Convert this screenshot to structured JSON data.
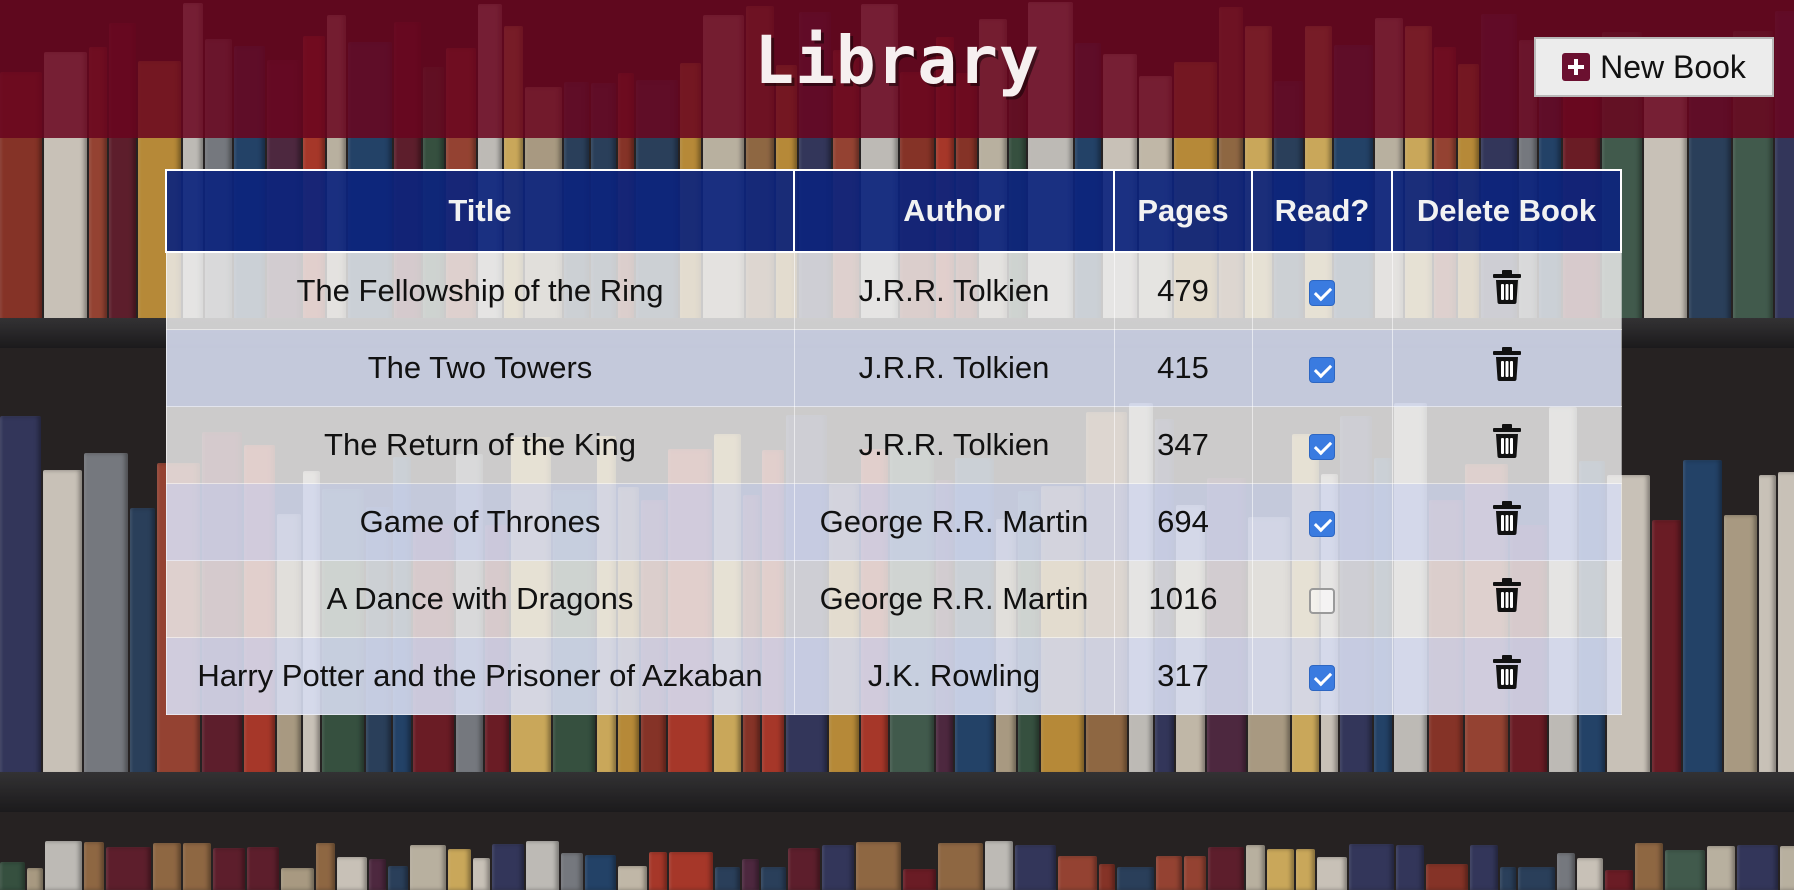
{
  "header": {
    "title": "Library",
    "new_book_label": "New Book",
    "new_book_icon": "plus-square-icon",
    "background_color": "#6a051e"
  },
  "table": {
    "columns": [
      "Title",
      "Author",
      "Pages",
      "Read?",
      "Delete Book"
    ],
    "header_color": "#0c247d",
    "delete_icon": "trash-icon",
    "rows": [
      {
        "title": "The Fellowship of the Ring",
        "author": "J.R.R. Tolkien",
        "pages": "479",
        "read": true
      },
      {
        "title": "The Two Towers",
        "author": "J.R.R. Tolkien",
        "pages": "415",
        "read": true
      },
      {
        "title": "The Return of the King",
        "author": "J.R.R. Tolkien",
        "pages": "347",
        "read": true
      },
      {
        "title": "Game of Thrones",
        "author": "George R.R. Martin",
        "pages": "694",
        "read": true
      },
      {
        "title": "A Dance with Dragons",
        "author": "George R.R. Martin",
        "pages": "1016",
        "read": false
      },
      {
        "title": "Harry Potter and the Prisoner of Azkaban",
        "author": "J.K. Rowling",
        "pages": "317",
        "read": true
      }
    ]
  },
  "checkbox_color": "#3a7be0"
}
